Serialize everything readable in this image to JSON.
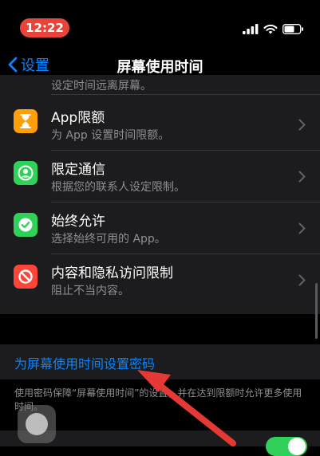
{
  "status": {
    "time": "12:22"
  },
  "nav": {
    "back_label": "设置",
    "title": "屏幕使用时间"
  },
  "rows": [
    {
      "title": "",
      "subtitle": "设定时间远离屏幕。",
      "icon": "moon-icon",
      "color": "#5e5ce6"
    },
    {
      "title": "App限额",
      "subtitle": "为 App 设置时间限额。",
      "icon": "hourglass-icon",
      "color": "#ff9f0a"
    },
    {
      "title": "限定通信",
      "subtitle": "根据您的联系人设定限制。",
      "icon": "person-circle-icon",
      "color": "#30d158"
    },
    {
      "title": "始终允许",
      "subtitle": "选择始终可用的 App。",
      "icon": "checkmark-seal-icon",
      "color": "#30d158"
    },
    {
      "title": "内容和隐私访问限制",
      "subtitle": "阻止不当内容。",
      "icon": "no-entry-icon",
      "color": "#ff453a"
    }
  ],
  "passcode": {
    "link_label": "为屏幕使用时间设置密码",
    "footer": "使用密码保障“屏幕使用时间”的设置，并在达到限额时允许更多使用时间。"
  },
  "colors": {
    "accent": "#0a84ff",
    "toggle_on": "#30d158",
    "annotation_arrow": "#e53935"
  },
  "toggle": {
    "on": true
  }
}
